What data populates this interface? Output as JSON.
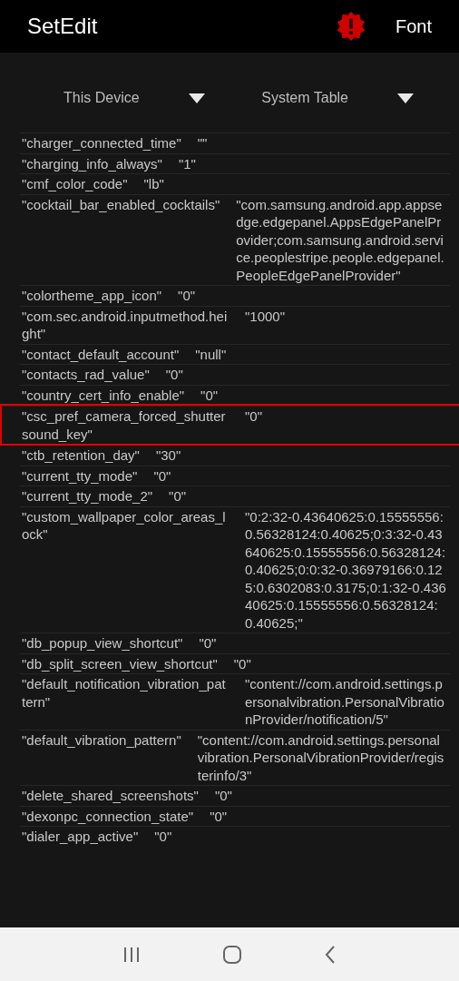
{
  "app_bar": {
    "title": "SetEdit",
    "action": "Font"
  },
  "selectors": [
    {
      "label": "This Device"
    },
    {
      "label": "System Table"
    }
  ],
  "rows": [
    {
      "key": "\"charger_connected_time\"",
      "value": "\"\"",
      "highlighted": false
    },
    {
      "key": "\"charging_info_always\"",
      "value": "\"1\"",
      "highlighted": false
    },
    {
      "key": "\"cmf_color_code\"",
      "value": "\"lb\"",
      "highlighted": false
    },
    {
      "key": "\"cocktail_bar_enabled_cocktails\"",
      "value": "\"com.samsung.android.app.appsedge.edgepanel.AppsEdgePanelProvider;com.samsung.android.service.peoplestripe.people.edgepanel.PeopleEdgePanelProvider\"",
      "highlighted": false
    },
    {
      "key": "\"colortheme_app_icon\"",
      "value": "\"0\"",
      "highlighted": false
    },
    {
      "key": "\"com.sec.android.inputmethod.height\"",
      "value": "\"1000\"",
      "highlighted": false
    },
    {
      "key": "\"contact_default_account\"",
      "value": "\"null\"",
      "highlighted": false
    },
    {
      "key": "\"contacts_rad_value\"",
      "value": "\"0\"",
      "highlighted": false
    },
    {
      "key": "\"country_cert_info_enable\"",
      "value": "\"0\"",
      "highlighted": false
    },
    {
      "key": "\"csc_pref_camera_forced_shuttersound_key\"",
      "value": "\"0\"",
      "highlighted": true
    },
    {
      "key": "\"ctb_retention_day\"",
      "value": "\"30\"",
      "highlighted": false
    },
    {
      "key": "\"current_tty_mode\"",
      "value": "\"0\"",
      "highlighted": false
    },
    {
      "key": "\"current_tty_mode_2\"",
      "value": "\"0\"",
      "highlighted": false
    },
    {
      "key": "\"custom_wallpaper_color_areas_lock\"",
      "value": "\"0:2:32-0.43640625:0.15555556:0.56328124:0.40625;0:3:32-0.43640625:0.15555556:0.56328124:0.40625;0:0:32-0.36979166:0.125:0.6302083:0.3175;0:1:32-0.43640625:0.15555556:0.56328124:0.40625;\"",
      "highlighted": false
    },
    {
      "key": "\"db_popup_view_shortcut\"",
      "value": "\"0\"",
      "highlighted": false
    },
    {
      "key": "\"db_split_screen_view_shortcut\"",
      "value": "\"0\"",
      "highlighted": false
    },
    {
      "key": "\"default_notification_vibration_pattern\"",
      "value": "\"content://com.android.settings.personalvibration.PersonalVibrationProvider/notification/5\"",
      "highlighted": false
    },
    {
      "key": "\"default_vibration_pattern\"",
      "value": "\"content://com.android.settings.personalvibration.PersonalVibrationProvider/registerinfo/3\"",
      "highlighted": false
    },
    {
      "key": "\"delete_shared_screenshots\"",
      "value": "\"0\"",
      "highlighted": false
    },
    {
      "key": "\"dexonpc_connection_state\"",
      "value": "\"0\"",
      "highlighted": false
    },
    {
      "key": "\"dialer_app_active\"",
      "value": "\"0\"",
      "highlighted": false
    }
  ]
}
